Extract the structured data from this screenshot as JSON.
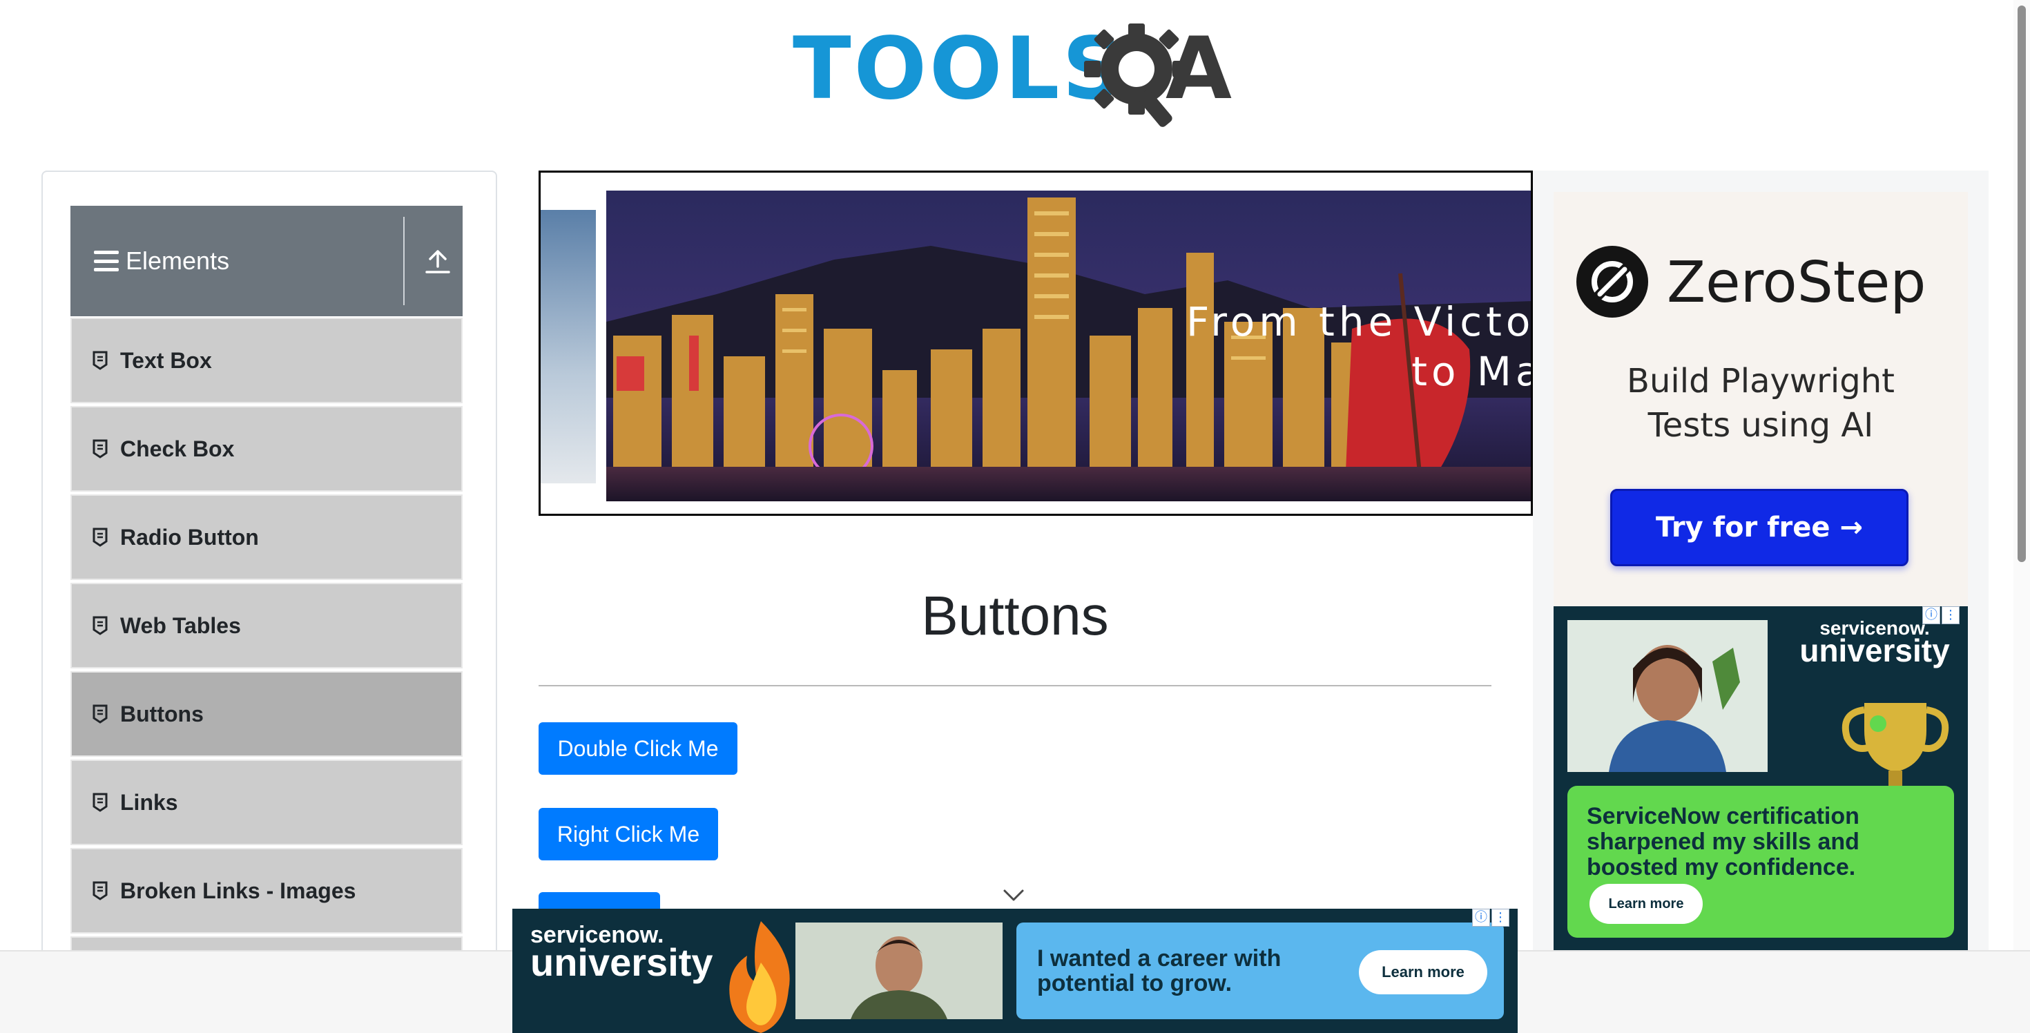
{
  "header": {
    "logo_text": "TOOLS",
    "logo_text_suffix": "A",
    "logo_icon": "gear-magnifier-icon"
  },
  "sidebar": {
    "group_title": "Elements",
    "group_icon": "hamburger-icon",
    "collapse_icon": "upload-arrow-icon",
    "items": [
      {
        "label": "Text Box",
        "icon": "file-icon",
        "active": false
      },
      {
        "label": "Check Box",
        "icon": "file-icon",
        "active": false
      },
      {
        "label": "Radio Button",
        "icon": "file-icon",
        "active": false
      },
      {
        "label": "Web Tables",
        "icon": "file-icon",
        "active": false
      },
      {
        "label": "Buttons",
        "icon": "file-icon",
        "active": true
      },
      {
        "label": "Links",
        "icon": "file-icon",
        "active": false
      },
      {
        "label": "Broken Links - Images",
        "icon": "file-icon",
        "active": false
      }
    ]
  },
  "banner": {
    "headline_line1": "From the Victoria",
    "headline_line2": "to Maca"
  },
  "main": {
    "title": "Buttons",
    "buttons": {
      "double_click": "Double Click Me",
      "right_click": "Right Click Me",
      "click": ""
    }
  },
  "ads": {
    "zerostep": {
      "brand": "ZeroStep",
      "tagline_line1": "Build Playwright",
      "tagline_line2": "Tests using AI",
      "cta": "Try for free →"
    },
    "servicenow_side": {
      "brand_small": "servicenow.",
      "brand_big": "university",
      "quote": "ServiceNow certification sharpened my skills and boosted my confidence.",
      "cta": "Learn more",
      "info_icon": "ⓘ",
      "menu_icon": "⋮"
    },
    "servicenow_bottom": {
      "brand_small": "servicenow.",
      "brand_big": "university",
      "headline": "I wanted a career with potential to grow.",
      "cta": "Learn more",
      "info_icon": "ⓘ",
      "menu_icon": "⋮"
    }
  },
  "colors": {
    "primary_button": "#007bff",
    "sidebar_header": "#6c757d",
    "sidebar_item": "#cccccc",
    "sidebar_item_active": "#b0b0b0",
    "logo_blue": "#1696d6",
    "zerostep_cta": "#1029e6",
    "servicenow_navy": "#0d2f3d",
    "servicenow_green": "#62d84e"
  }
}
